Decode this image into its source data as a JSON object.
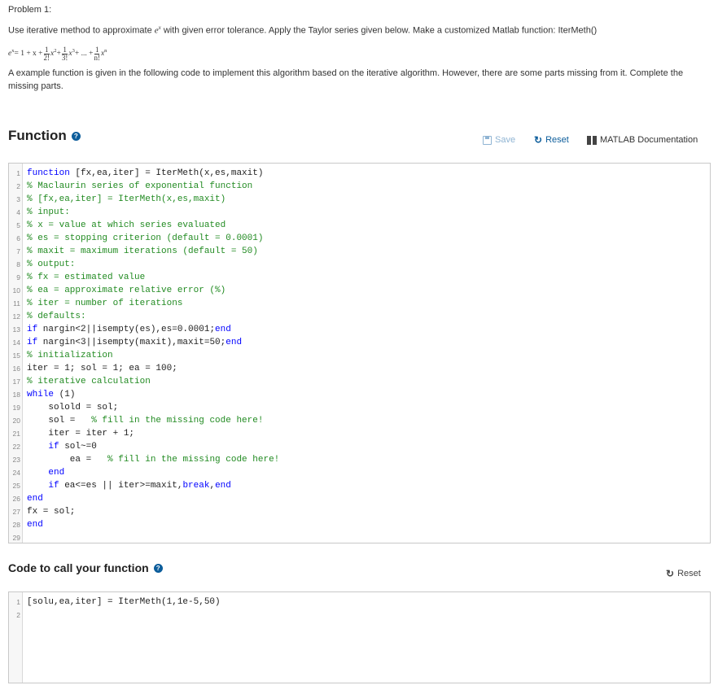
{
  "problem": {
    "title": "Problem 1:",
    "instructions_before": "Use iterative method to approximate ",
    "instructions_math": "e",
    "instructions_math_sup": "x",
    "instructions_after": " with given error tolerance. Apply the Taylor series given below. Make a customized Matlab function: IterMeth()",
    "formula": {
      "lhs": "e",
      "lhs_sup": "x",
      "eq": " = 1 + x + ",
      "t1_num": "1",
      "t1_den": "2!",
      "t1_var": "x",
      "t1_sup": "2",
      "plus1": " + ",
      "t2_num": "1",
      "t2_den": "3!",
      "t2_var": "x",
      "t2_sup": "3",
      "ellipsis": " + ... + ",
      "tn_num": "1",
      "tn_den": "n!",
      "tn_var": "x",
      "tn_sup": "n"
    },
    "paragraph": "A example function is given in the following code to implement this algorithm based on the iterative algorithm. However, there are some parts missing from it. Complete the missing parts."
  },
  "function_section": {
    "title": "Function",
    "help_icon": "question-circle-icon",
    "save_label": "Save",
    "reset_label": "Reset",
    "docs_label": "MATLAB Documentation",
    "code_lines": [
      [
        {
          "t": "function",
          "c": "kw"
        },
        {
          "t": " [fx,ea,iter] = IterMeth(x,es,maxit)"
        }
      ],
      [
        {
          "t": "% Maclaurin series of exponential function",
          "c": "cm"
        }
      ],
      [
        {
          "t": "% [fx,ea,iter] = IterMeth(x,es,maxit)",
          "c": "cm"
        }
      ],
      [
        {
          "t": "% input:",
          "c": "cm"
        }
      ],
      [
        {
          "t": "% x = value at which series evaluated",
          "c": "cm"
        }
      ],
      [
        {
          "t": "% es = stopping criterion (default = 0.0001)",
          "c": "cm"
        }
      ],
      [
        {
          "t": "% maxit = maximum iterations (default = 50)",
          "c": "cm"
        }
      ],
      [
        {
          "t": "% output:",
          "c": "cm"
        }
      ],
      [
        {
          "t": "% fx = estimated value",
          "c": "cm"
        }
      ],
      [
        {
          "t": "% ea = approximate relative error (%)",
          "c": "cm"
        }
      ],
      [
        {
          "t": "% iter = number of iterations",
          "c": "cm"
        }
      ],
      [
        {
          "t": "% defaults:",
          "c": "cm"
        }
      ],
      [
        {
          "t": "if",
          "c": "kw"
        },
        {
          "t": " nargin<2||isempty(es),es=0.0001;"
        },
        {
          "t": "end",
          "c": "kw"
        }
      ],
      [
        {
          "t": "if",
          "c": "kw"
        },
        {
          "t": " nargin<3||isempty(maxit),maxit=50;"
        },
        {
          "t": "end",
          "c": "kw"
        }
      ],
      [
        {
          "t": "% initialization",
          "c": "cm"
        }
      ],
      [
        {
          "t": "iter = 1; sol = 1; ea = 100;"
        }
      ],
      [
        {
          "t": "% iterative calculation",
          "c": "cm"
        }
      ],
      [
        {
          "t": "while",
          "c": "kw"
        },
        {
          "t": " (1)"
        }
      ],
      [
        {
          "t": "    solold = sol;"
        }
      ],
      [
        {
          "t": "    sol =   "
        },
        {
          "t": "% fill in the missing code here!",
          "c": "cm"
        }
      ],
      [
        {
          "t": "    iter = iter + 1;"
        }
      ],
      [
        {
          "t": "    "
        },
        {
          "t": "if",
          "c": "kw"
        },
        {
          "t": " sol~=0"
        }
      ],
      [
        {
          "t": "        ea =   "
        },
        {
          "t": "% fill in the missing code here!",
          "c": "cm"
        }
      ],
      [
        {
          "t": "    "
        },
        {
          "t": "end",
          "c": "kw"
        }
      ],
      [
        {
          "t": "    "
        },
        {
          "t": "if",
          "c": "kw"
        },
        {
          "t": " ea<=es || iter>=maxit,"
        },
        {
          "t": "break",
          "c": "kw"
        },
        {
          "t": ","
        },
        {
          "t": "end",
          "c": "kw"
        }
      ],
      [
        {
          "t": "end",
          "c": "kw"
        }
      ],
      [
        {
          "t": "fx = sol;"
        }
      ],
      [
        {
          "t": "end",
          "c": "kw"
        }
      ],
      []
    ]
  },
  "call_section": {
    "title": "Code to call your function",
    "help_icon": "question-circle-icon",
    "reset_label": "Reset",
    "code_lines": [
      [
        {
          "t": "[solu,ea,iter] = IterMeth(1,1e-5,50)"
        }
      ],
      []
    ]
  },
  "colors": {
    "keyword": "#0000ff",
    "comment": "#228b22",
    "link": "#0c5d9b",
    "disabled": "#8fb4d3"
  }
}
